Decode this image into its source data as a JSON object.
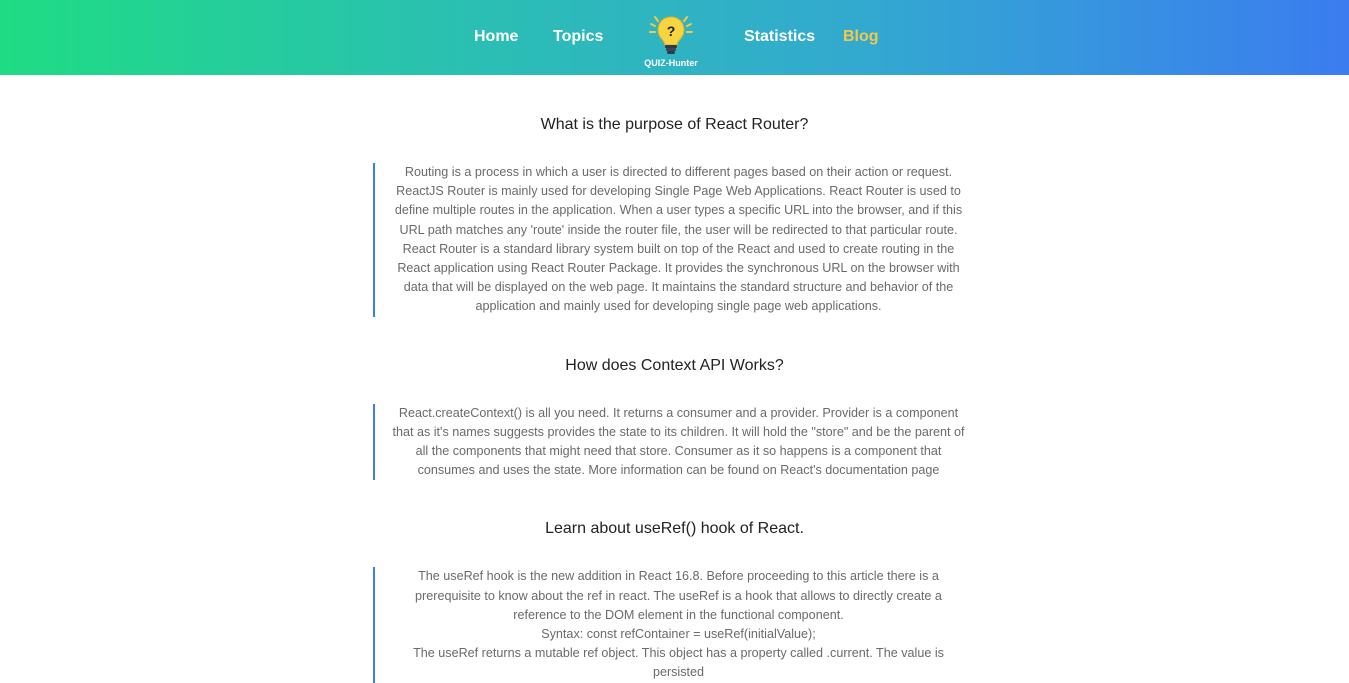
{
  "nav": {
    "items": [
      {
        "label": "Home"
      },
      {
        "label": "Topics"
      },
      {
        "label": "Statistics"
      },
      {
        "label": "Blog"
      }
    ],
    "logo_text": "QUIZ-Hunter",
    "active_color": "#f2c94c"
  },
  "colors": {
    "gradient_start": "#1fdc84",
    "gradient_end": "#3b7cf0",
    "accent_border": "#3b7cf0"
  },
  "blog": {
    "posts": [
      {
        "title": "What is the purpose of React Router?",
        "answer": "Routing is a process in which a user is directed to different pages based on their action or request. ReactJS Router is mainly used for developing Single Page Web Applications. React Router is used to define multiple routes in the application. When a user types a specific URL into the browser, and if this URL path matches any 'route' inside the router file, the user will be redirected to that particular route. React Router is a standard library system built on top of the React and used to create routing in the React application using React Router Package. It provides the synchronous URL on the browser with data that will be displayed on the web page. It maintains the standard structure and behavior of the application and mainly used for developing single page web applications."
      },
      {
        "title": "How does Context API Works?",
        "answer": "React.createContext() is all you need. It returns a consumer and a provider. Provider is a component that as it's names suggests provides the state to its children. It will hold the \"store\" and be the parent of all the components that might need that store. Consumer as it so happens is a component that consumes and uses the state. More information can be found on React's documentation page"
      },
      {
        "title": "Learn about useRef() hook of React.",
        "answer": "The useRef hook is the new addition in React 16.8. Before proceeding to this article there is a prerequisite to know about the ref in react. The useRef is a hook that allows to directly create a reference to the DOM element in the functional component.\nSyntax: const refContainer = useRef(initialValue);\nThe useRef returns a mutable ref object. This object has a property called .current. The value is persisted"
      }
    ]
  }
}
